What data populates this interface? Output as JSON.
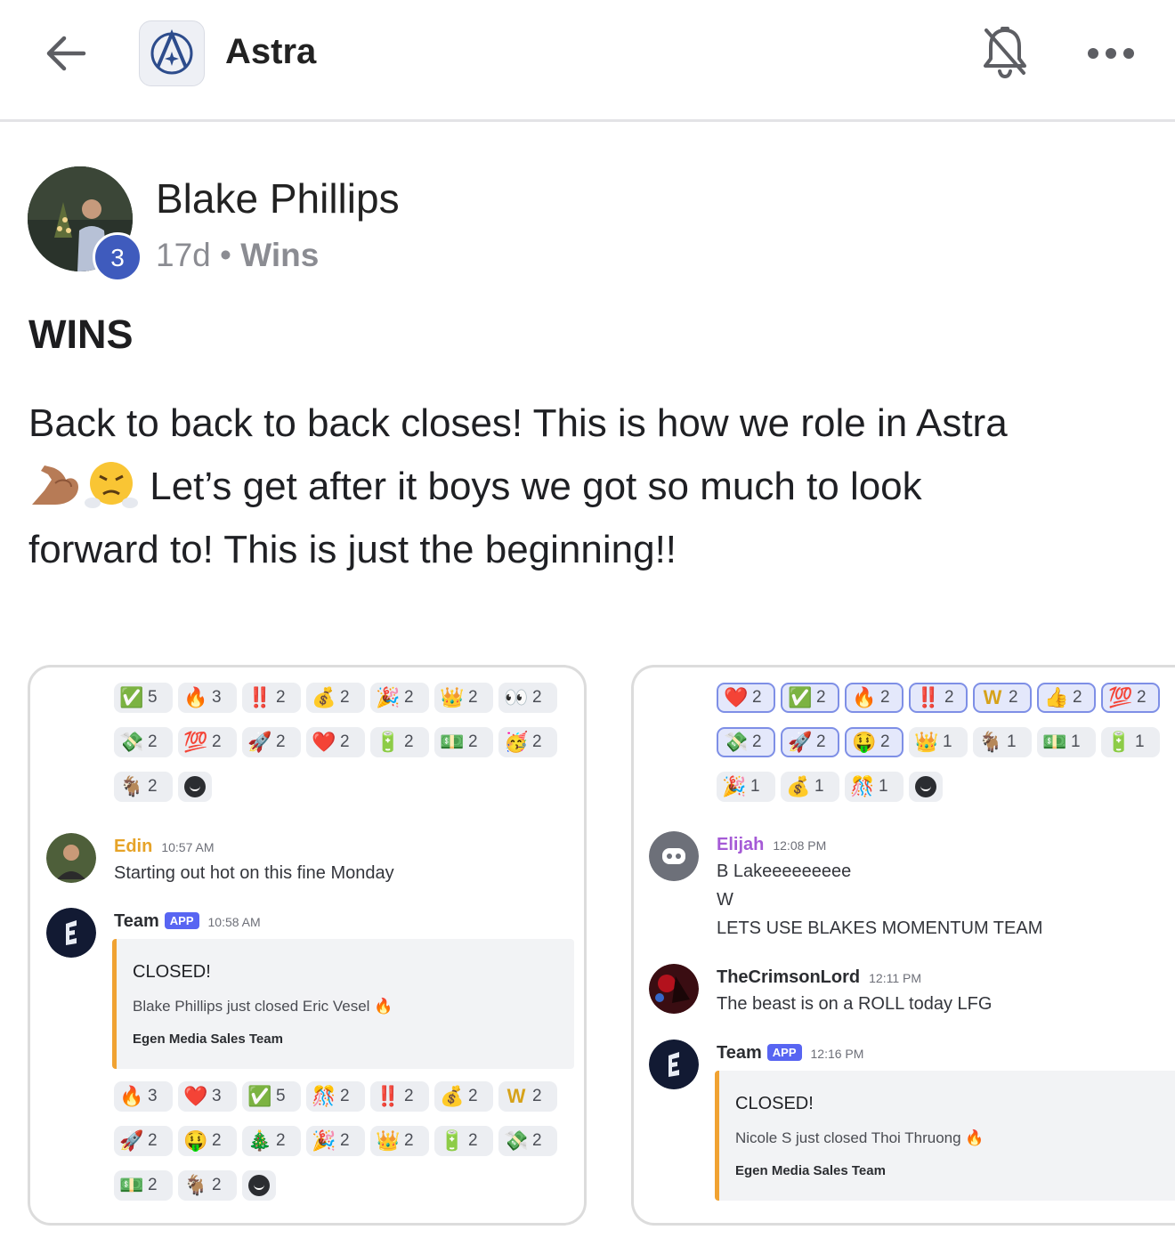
{
  "header": {
    "app_name": "Astra",
    "back_icon": "arrow-left-icon",
    "bell_icon": "bell-off-icon",
    "more_icon": "more-horizontal-icon"
  },
  "post": {
    "author": "Blake Phillips",
    "level": "3",
    "age": "17d",
    "separator": "•",
    "category": "Wins",
    "title": "WINS",
    "body_line1": "Back to back to back closes! This is how we role in Astra",
    "body_line2": " Let’s get after it boys we got so much to look",
    "body_line3": "forward to! This is just the beginning!!",
    "body_emojis": [
      "flexed-biceps-icon",
      "face-with-steam-icon"
    ]
  },
  "left_card": {
    "reactions_top": [
      [
        {
          "e": "✅",
          "n": "5"
        },
        {
          "e": "🔥",
          "n": "3"
        },
        {
          "e": "‼️",
          "n": "2"
        },
        {
          "e": "💰",
          "n": "2"
        },
        {
          "e": "🎉",
          "n": "2"
        },
        {
          "e": "👑",
          "n": "2"
        },
        {
          "e": "👀",
          "n": "2"
        }
      ],
      [
        {
          "e": "💸",
          "n": "2"
        },
        {
          "e": "💯",
          "n": "2"
        },
        {
          "e": "🚀",
          "n": "2"
        },
        {
          "e": "❤️",
          "n": "2"
        },
        {
          "e": "🔋",
          "n": "2"
        },
        {
          "e": "💵",
          "n": "2"
        },
        {
          "e": "🥳",
          "n": "2"
        }
      ],
      [
        {
          "e": "🐐",
          "n": "2"
        }
      ]
    ],
    "messages": [
      {
        "name": "Edin",
        "time": "10:57 AM",
        "text": "Starting out hot on this fine Monday"
      },
      {
        "name": "Team",
        "tag": "APP",
        "time": "10:58 AM"
      }
    ],
    "embed": {
      "title": "CLOSED!",
      "desc": "Blake Phillips just closed Eric Vesel 🔥",
      "footer": "Egen Media Sales Team"
    },
    "reactions_bottom": [
      [
        {
          "e": "🔥",
          "n": "3"
        },
        {
          "e": "❤️",
          "n": "3"
        },
        {
          "e": "✅",
          "n": "5"
        },
        {
          "e": "🎊",
          "n": "2"
        },
        {
          "e": "‼️",
          "n": "2"
        },
        {
          "e": "💰",
          "n": "2"
        },
        {
          "e": "W",
          "n": "2"
        }
      ],
      [
        {
          "e": "🚀",
          "n": "2"
        },
        {
          "e": "🤑",
          "n": "2"
        },
        {
          "e": "🎄",
          "n": "2"
        },
        {
          "e": "🎉",
          "n": "2"
        },
        {
          "e": "👑",
          "n": "2"
        },
        {
          "e": "🔋",
          "n": "2"
        },
        {
          "e": "💸",
          "n": "2"
        }
      ],
      [
        {
          "e": "💵",
          "n": "2"
        },
        {
          "e": "🐐",
          "n": "2"
        }
      ]
    ]
  },
  "right_card": {
    "reactions_top": [
      [
        {
          "e": "❤️",
          "n": "2",
          "s": true
        },
        {
          "e": "✅",
          "n": "2",
          "s": true
        },
        {
          "e": "🔥",
          "n": "2",
          "s": true
        },
        {
          "e": "‼️",
          "n": "2",
          "s": true
        },
        {
          "e": "W",
          "n": "2",
          "s": true
        },
        {
          "e": "👍",
          "n": "2",
          "s": true
        },
        {
          "e": "💯",
          "n": "2",
          "s": true
        }
      ],
      [
        {
          "e": "💸",
          "n": "2",
          "s": true
        },
        {
          "e": "🚀",
          "n": "2",
          "s": true
        },
        {
          "e": "🤑",
          "n": "2",
          "s": true
        },
        {
          "e": "👑",
          "n": "1"
        },
        {
          "e": "🐐",
          "n": "1"
        },
        {
          "e": "💵",
          "n": "1"
        },
        {
          "e": "🔋",
          "n": "1"
        }
      ],
      [
        {
          "e": "🎉",
          "n": "1"
        },
        {
          "e": "💰",
          "n": "1"
        },
        {
          "e": "🎊",
          "n": "1"
        }
      ]
    ],
    "messages": [
      {
        "name": "Elijah",
        "time": "12:08 PM",
        "lines": [
          "B Lakeeeeeeeee",
          "W",
          "LETS USE BLAKES MOMENTUM TEAM"
        ]
      },
      {
        "name": "TheCrimsonLord",
        "time": "12:11 PM",
        "lines": [
          "The beast is on a ROLL today LFG"
        ]
      },
      {
        "name": "Team",
        "tag": "APP",
        "time": "12:16 PM"
      }
    ],
    "embed": {
      "title": "CLOSED!",
      "desc": "Nicole S just closed Thoi Thruong 🔥",
      "footer": "Egen Media Sales Team"
    }
  }
}
